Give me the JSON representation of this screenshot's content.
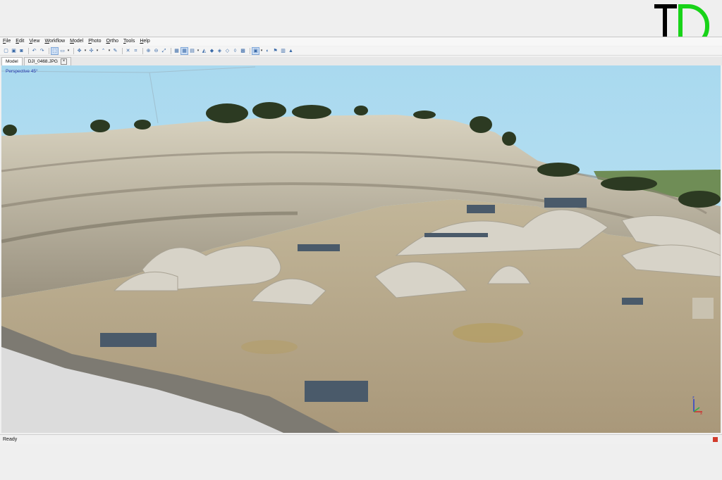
{
  "menu": {
    "items": [
      "File",
      "Edit",
      "View",
      "Workflow",
      "Model",
      "Photo",
      "Ortho",
      "Tools",
      "Help"
    ]
  },
  "toolbar": {
    "icons": [
      "new-icon",
      "open-icon",
      "save-icon",
      "sep",
      "undo-icon",
      "redo-icon",
      "sep",
      "select-rectangle-icon",
      "select-dropdown-icon",
      "rect-selection-icon",
      "sep",
      "navigation-icon",
      "navigation-dropdown-icon",
      "move-icon",
      "move-dropdown-icon",
      "draw-icon",
      "draw-dropdown-icon",
      "ruler-icon",
      "sep",
      "delete-icon",
      "crop-icon",
      "sep",
      "zoom-in-icon",
      "zoom-out-icon",
      "reset-view-icon",
      "sep",
      "grid-icon",
      "grid-active-icon",
      "grid2-icon",
      "grid2-dropdown-icon",
      "shape1-icon",
      "shape2-icon",
      "shape3-icon",
      "shape4-icon",
      "shape5-icon",
      "texture-icon",
      "sep",
      "model-view-icon",
      "model-view-dropdown-icon",
      "cameras-icon",
      "markers-icon",
      "region-icon",
      "shading-icon"
    ]
  },
  "tabs": [
    {
      "label": "Model",
      "active": true,
      "closable": false
    },
    {
      "label": "DJI_0468.JPG",
      "active": false,
      "closable": true
    }
  ],
  "viewport": {
    "label": "Perspective 45°",
    "colors": {
      "sky": "#b4def0",
      "ground": "#b5a88e",
      "rock": "#cfc7b4",
      "trees": "#2c3a22"
    }
  },
  "status": {
    "text": "Ready"
  },
  "logo": {
    "text": "TD",
    "colors": {
      "t": "#000000",
      "d": "#18d318"
    }
  }
}
